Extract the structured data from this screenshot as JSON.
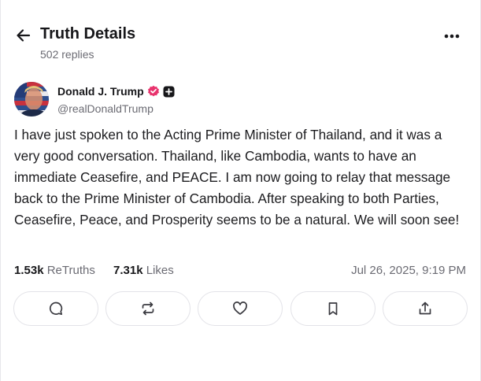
{
  "header": {
    "title": "Truth Details",
    "replies": "502 replies"
  },
  "author": {
    "display_name": "Donald J. Trump",
    "handle": "@realDonaldTrump"
  },
  "post": {
    "text": "I have just spoken to the Acting Prime Minister of Thailand, and it was a very good conversation. Thailand, like Cambodia, wants to have an immediate Ceasefire, and PEACE. I am now going to relay that message back to the Prime Minister of Cambodia. After speaking to both Parties, Ceasefire, Peace, and Prosperity seems to be a natural. We will soon see!"
  },
  "stats": {
    "retruths_count": "1.53k",
    "retruths_label": "ReTruths",
    "likes_count": "7.31k",
    "likes_label": "Likes",
    "timestamp": "Jul 26, 2025, 9:19 PM"
  },
  "icons": {
    "back": "arrow-left-icon",
    "more": "more-horizontal-icon",
    "verified": "verified-badge-icon",
    "plus": "plus-badge-icon",
    "reply": "chat-bubble-icon",
    "retruth": "repost-icon",
    "like": "heart-icon",
    "bookmark": "bookmark-icon",
    "share": "share-icon"
  },
  "colors": {
    "verified": "#e8336d",
    "text": "#1c1c1f",
    "muted": "#6b6b73",
    "border": "#e3e3e8"
  }
}
